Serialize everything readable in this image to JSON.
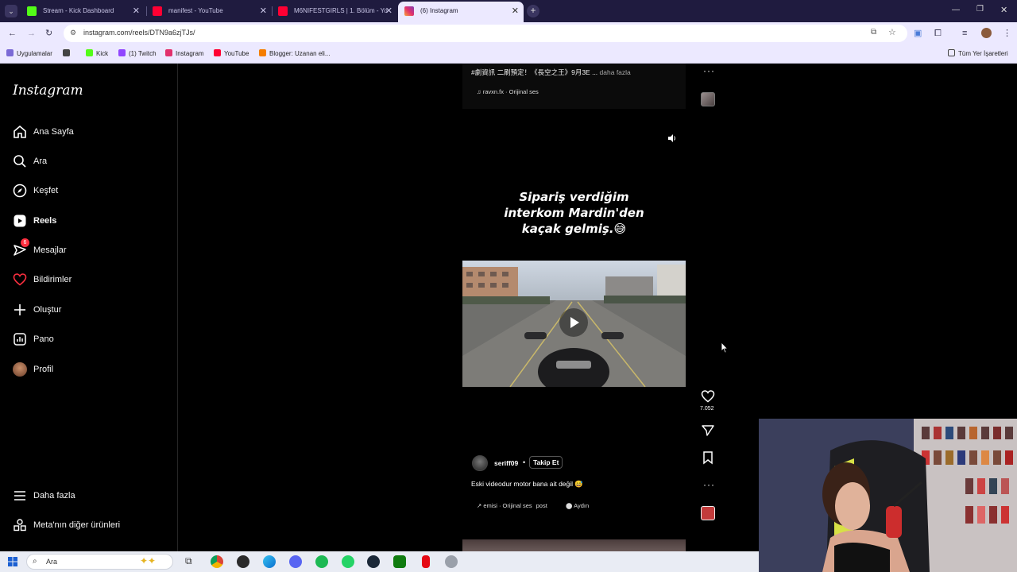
{
  "browser": {
    "tabs": [
      {
        "label": "Stream - Kick Dashboard",
        "active": false
      },
      {
        "label": "manifest - YouTube",
        "active": false
      },
      {
        "label": "M6NIFESTGIRLS | 1. Bölüm - Yo",
        "active": false
      },
      {
        "label": "(6) Instagram",
        "active": true
      }
    ],
    "url": "instagram.com/reels/DTN9a6zjTJs/",
    "bookmarks": [
      "Uygulamalar",
      "Kick",
      "(1) Twitch",
      "Instagram",
      "YouTube",
      "Blogger: Uzanan eli..."
    ],
    "all_bookmarks_label": "Tüm Yer İşaretleri"
  },
  "sidebar": {
    "logo": "Instagram",
    "items": [
      {
        "label": "Ana Sayfa",
        "icon": "home-icon"
      },
      {
        "label": "Ara",
        "icon": "search-icon"
      },
      {
        "label": "Keşfet",
        "icon": "compass-icon"
      },
      {
        "label": "Reels",
        "icon": "reels-icon",
        "active": true
      },
      {
        "label": "Mesajlar",
        "icon": "messages-icon",
        "badge": "6"
      },
      {
        "label": "Bildirimler",
        "icon": "heart-icon"
      },
      {
        "label": "Oluştur",
        "icon": "plus-icon"
      },
      {
        "label": "Pano",
        "icon": "dashboard-icon"
      },
      {
        "label": "Profil",
        "icon": "avatar-icon"
      }
    ],
    "more": "Daha fazla",
    "meta": "Meta'nın diğer ürünleri"
  },
  "previous_post": {
    "caption": "#劇資訊 二刷預定！《長空之王》9月3E ...",
    "more": "daha fazla",
    "audio": "ravxn.fx · Orijinal ses"
  },
  "reel": {
    "overlay_text_lines": [
      "Sipariş verdiğim",
      "interkom Mardin'den",
      "kaçak gelmiş.😅"
    ],
    "username": "seriff09",
    "follow": "Takip Et",
    "caption": "Eski videodur motor bana ait değil 😅",
    "audio": "emisi · Orijinal ses",
    "audio_tail": "post",
    "location": "Aydın",
    "likes": "7.052"
  },
  "taskbar": {
    "search_placeholder": "Ara"
  }
}
